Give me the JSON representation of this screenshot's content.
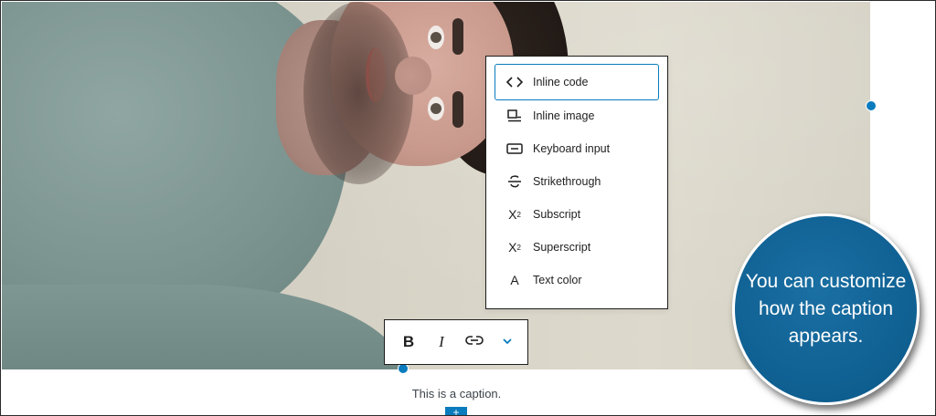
{
  "dropdown": {
    "items": [
      {
        "label": "Inline code",
        "icon": "code-icon",
        "active": true
      },
      {
        "label": "Inline image",
        "icon": "image-icon"
      },
      {
        "label": "Keyboard input",
        "icon": "keyboard-icon"
      },
      {
        "label": "Strikethrough",
        "icon": "strikethrough-icon"
      },
      {
        "label": "Subscript",
        "icon": "subscript-icon"
      },
      {
        "label": "Superscript",
        "icon": "superscript-icon"
      },
      {
        "label": "Text color",
        "icon": "text-color-icon"
      }
    ]
  },
  "toolbar": {
    "bold_glyph": "B",
    "italic_glyph": "I",
    "link_icon": "link-icon",
    "more_icon": "chevron-down-icon"
  },
  "caption": "This is a caption.",
  "inserter_glyph": "+",
  "callout": "You can customize how the caption appears.",
  "colors": {
    "accent": "#0a7bbd",
    "callout_bg": "#0f5f91"
  }
}
